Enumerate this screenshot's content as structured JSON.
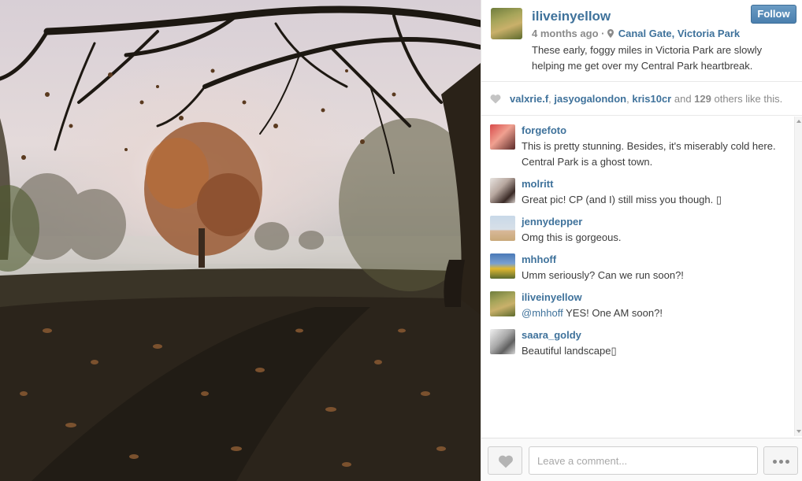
{
  "post": {
    "username": "iliveinyellow",
    "time_ago": "4 months ago",
    "separator": "·",
    "location": "Canal Gate, Victoria Park",
    "caption": "These early, foggy miles in Victoria Park are slowly helping me get over my Central Park heartbreak.",
    "follow_label": "Follow"
  },
  "likes": {
    "users": [
      "valxrie.f",
      "jasyogalondon",
      "kris10cr"
    ],
    "sep1": ", ",
    "sep2": ", ",
    "and_text": " and ",
    "count": "129",
    "suffix": " others like this."
  },
  "comments": [
    {
      "user": "forgefoto",
      "text": "This is pretty stunning. Besides, it's miserably cold here. Central Park is a ghost town."
    },
    {
      "user": "molritt",
      "text": "Great pic! CP (and I) still miss you though. ▯"
    },
    {
      "user": "jennydepper",
      "text": "Omg this is gorgeous."
    },
    {
      "user": "mhhoff",
      "text": "Umm seriously? Can we run soon?!"
    },
    {
      "user": "iliveinyellow",
      "mention": "@mhhoff",
      "text": " YES! One AM soon?!"
    },
    {
      "user": "saara_goldy",
      "text": "Beautiful landscape▯"
    }
  ],
  "footer": {
    "comment_placeholder": "Leave a comment..."
  },
  "icons": {
    "location": "map-pin-icon",
    "like": "heart-icon",
    "more": "ellipsis-icon"
  },
  "colors": {
    "link": "#3f729b",
    "follow_button": "#4a7fae"
  }
}
